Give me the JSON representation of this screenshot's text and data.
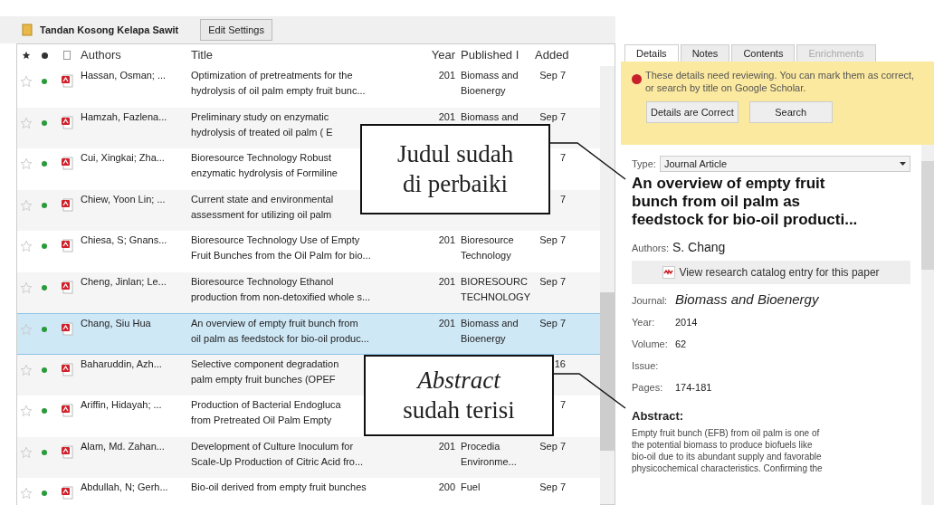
{
  "toolbar": {
    "folder": "Tandan Kosong Kelapa Sawit",
    "button": "Edit Settings"
  },
  "table": {
    "columns": [
      "Authors",
      "Title",
      "Year",
      "Published I",
      "Added"
    ],
    "rows": [
      {
        "starred": false,
        "unread": true,
        "selected": false,
        "authors": "Hassan, Osman; ...",
        "title": "Optimization of pretreatments for the\nhydrolysis of oil palm empty fruit bunc...",
        "year": "201",
        "published": "Biomass and\nBioenergy",
        "added": "Sep 7"
      },
      {
        "starred": false,
        "unread": true,
        "selected": false,
        "authors": "Hamzah, Fazlena...",
        "title": "Preliminary study on enzymatic\nhydrolysis of treated oil palm ( E",
        "year": "201",
        "published": "Biomass and",
        "added": "Sep 7"
      },
      {
        "starred": false,
        "unread": true,
        "selected": false,
        "authors": "Cui, Xingkai; Zha...",
        "title": "Bioresource Technology Robust\nenzymatic hydrolysis of Formiline",
        "added": "7"
      },
      {
        "starred": false,
        "unread": true,
        "selected": false,
        "authors": "Chiew, Yoon Lin; ...",
        "title": "Current state and environmental\nassessment for utilizing oil palm",
        "added": "7"
      },
      {
        "starred": false,
        "unread": true,
        "selected": false,
        "authors": "Chiesa, S; Gnans...",
        "title": "Bioresource Technology Use of Empty\nFruit Bunches from the Oil Palm for bio...",
        "year": "201",
        "published": "Bioresource\nTechnology",
        "added": "Sep 7"
      },
      {
        "starred": false,
        "unread": true,
        "selected": false,
        "authors": "Cheng, Jinlan; Le...",
        "title": "Bioresource Technology Ethanol\nproduction from non-detoxified whole s...",
        "year": "201",
        "published": "BIORESOURC\nTECHNOLOGY",
        "added": "Sep 7"
      },
      {
        "starred": false,
        "unread": true,
        "selected": true,
        "authors": "Chang, Siu Hua",
        "title": "An overview of empty fruit bunch from\noil palm as feedstock for bio-oil produc...",
        "year": "201",
        "published": "Biomass and\nBioenergy",
        "added": "Sep 7"
      },
      {
        "starred": false,
        "unread": true,
        "selected": false,
        "authors": "Baharuddin, Azh...",
        "title": "Selective component degradation\npalm empty fruit bunches (OPEF",
        "added": "16"
      },
      {
        "starred": false,
        "unread": true,
        "selected": false,
        "authors": "Ariffin, Hidayah; ...",
        "title": "Production of Bacterial Endogluca\nfrom Pretreated Oil Palm Empty",
        "added": "7"
      },
      {
        "starred": false,
        "unread": true,
        "selected": false,
        "authors": "Alam, Md. Zahan...",
        "title": "Development of Culture Inoculum for\nScale-Up Production of Citric Acid fro...",
        "year": "201",
        "published": "Procedia\nEnvironme...",
        "added": "Sep 7"
      },
      {
        "starred": false,
        "unread": true,
        "selected": false,
        "authors": "Abdullah, N; Gerh...",
        "title": "Bio-oil derived from empty fruit bunches",
        "year": "200",
        "published": "Fuel",
        "added": "Sep 7"
      }
    ]
  },
  "details": {
    "tabs": [
      {
        "label": "Details",
        "selected": true,
        "disabled": false
      },
      {
        "label": "Notes",
        "selected": false,
        "disabled": false
      },
      {
        "label": "Contents",
        "selected": false,
        "disabled": false
      },
      {
        "label": "Enrichments",
        "selected": false,
        "disabled": true
      }
    ],
    "notice": "These details need reviewing. You can mark them as correct, or search by title on Google Scholar.",
    "notice_buttons": [
      "Details are Correct",
      "Search"
    ],
    "type_label": "Type:",
    "type_value": "Journal Article",
    "title": "An overview of empty fruit\nbunch from oil palm as\nfeedstock for bio-oil producti...",
    "authors_label": "Authors:",
    "authors_value": "S. Chang",
    "catalog_link": "View research catalog entry for this paper",
    "fields": [
      {
        "label": "Journal:",
        "value": "Biomass and Bioenergy",
        "kind": "italic"
      },
      {
        "label": "Year:",
        "value": "2014",
        "kind": "plain"
      },
      {
        "label": "Volume:",
        "value": "62",
        "kind": "plain"
      },
      {
        "label": "Issue:",
        "kind": "plain"
      },
      {
        "label": "Pages:",
        "value": "174-181",
        "kind": "plain"
      }
    ],
    "abstract_label": "Abstract:",
    "abstract": "Empty fruit bunch (EFB) from oil palm is one of\nthe potential biomass to produce biofuels like\nbio-oil due to its abundant supply and favorable\nphysicochemical characteristics. Confirming the"
  },
  "callouts": [
    "Judul sudah\ndi perbaiki",
    "*Abstract*\nsudah terisi"
  ]
}
